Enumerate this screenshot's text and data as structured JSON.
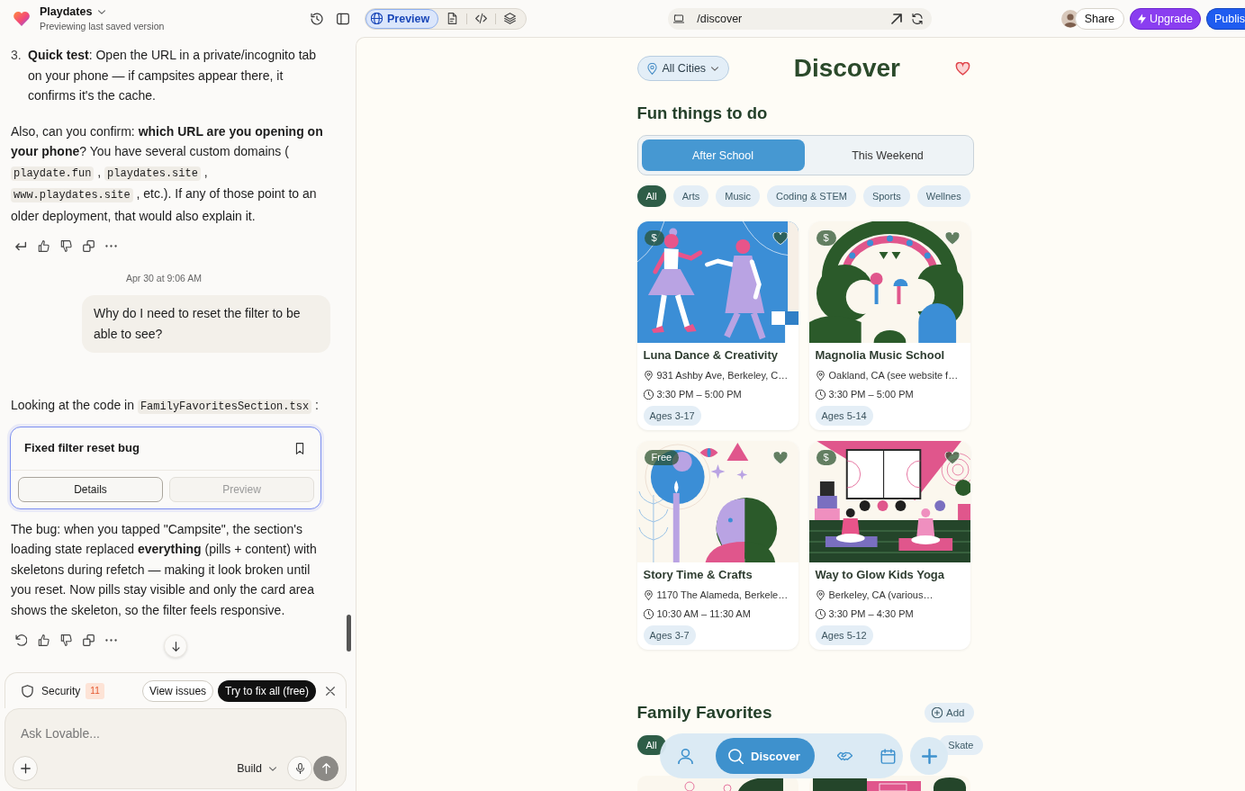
{
  "topbar": {
    "project": "Playdates",
    "subtitle": "Previewing last saved version",
    "view_tabs": [
      {
        "label": "Preview",
        "selected": true
      },
      {
        "selected": false
      },
      {
        "selected": false
      },
      {
        "selected": false
      }
    ],
    "url": "/discover",
    "share": "Share",
    "upgrade": "Upgrade",
    "publish": "Publis"
  },
  "chat": {
    "list_item": {
      "number": "3.",
      "text": "**Quick test**: Open the URL in a private/incognito tab on your phone — if campsites appear there, it confirms it's the cache."
    },
    "answer": [
      {
        "kind": "text",
        "text": "Also, can you confirm: **which URL are you opening on your phone**? You have several custom domains ( "
      },
      {
        "kind": "code",
        "text": "playdate.fun"
      },
      {
        "kind": "text",
        "text": " , "
      },
      {
        "kind": "code",
        "text": "playdates.site"
      },
      {
        "kind": "text",
        "text": " , "
      },
      {
        "kind": "code",
        "text": "www.playdates.site"
      },
      {
        "kind": "text",
        "text": " , etc.). If any of those point to an older deployment, that would also explain it."
      }
    ],
    "timestamp": "Apr 30 at 9:06 AM",
    "user_message": "Why do I need to reset the filter to be able to see?",
    "intro": [
      {
        "kind": "text",
        "text": "Looking at the code in "
      },
      {
        "kind": "code",
        "text": "FamilyFavoritesSection.tsx"
      },
      {
        "kind": "text",
        "text": " :"
      }
    ],
    "change_card": {
      "title": "Fixed filter reset bug",
      "tabs": [
        {
          "label": "Details",
          "selected": true
        },
        {
          "label": "Preview",
          "selected": false
        }
      ]
    },
    "explanation": "The bug: when you tapped \"Campsite\", the section's loading state replaced **everything** (pills + content) with skeletons during refetch — making it look broken until you reset. Now pills stay visible and only the card area shows the skeleton, so the filter feels responsive.",
    "security": {
      "label": "Security",
      "count": "11",
      "view": "View issues",
      "fix": "Try to fix all (free)"
    },
    "composer": {
      "placeholder": "Ask Lovable...",
      "mode": "Build"
    }
  },
  "app": {
    "city": "All Cities",
    "title": "Discover",
    "section": "Fun things to do",
    "segments": [
      {
        "label": "After School",
        "selected": true
      },
      {
        "label": "This Weekend",
        "selected": false
      }
    ],
    "categories": [
      {
        "label": "All",
        "selected": true
      },
      {
        "label": "Arts",
        "selected": false
      },
      {
        "label": "Music",
        "selected": false
      },
      {
        "label": "Coding & STEM",
        "selected": false
      },
      {
        "label": "Sports",
        "selected": false
      },
      {
        "label": "Wellnes",
        "selected": false
      }
    ],
    "activities": [
      {
        "price": "$",
        "name": "Luna Dance & Creativity",
        "location": "931 Ashby Ave, Berkeley, C…",
        "time": "3:30 PM – 5:00 PM",
        "ages": "Ages 3-17"
      },
      {
        "price": "$",
        "name": "Magnolia Music School",
        "location": "Oakland, CA (see website f…",
        "time": "3:30 PM – 5:00 PM",
        "ages": "Ages 5-14"
      },
      {
        "price": "Free",
        "name": "Story Time & Crafts",
        "location": "1170 The Alameda, Berkele…",
        "time": "10:30 AM – 11:30 AM",
        "ages": "Ages 3-7"
      },
      {
        "price": "$",
        "name": "Way to Glow Kids Yoga",
        "location": "Berkeley, CA (various…",
        "time": "3:30 PM – 4:30 PM",
        "ages": "Ages 5-12"
      }
    ],
    "favorites": {
      "title": "Family Favorites",
      "add": "Add",
      "filters": [
        {
          "label": "All",
          "selected": true
        },
        {
          "label": "Skate",
          "selected": false
        }
      ]
    },
    "nav": [
      {
        "selected": false
      },
      {
        "label": "Discover",
        "selected": true
      },
      {
        "selected": false
      },
      {
        "selected": false
      }
    ]
  }
}
